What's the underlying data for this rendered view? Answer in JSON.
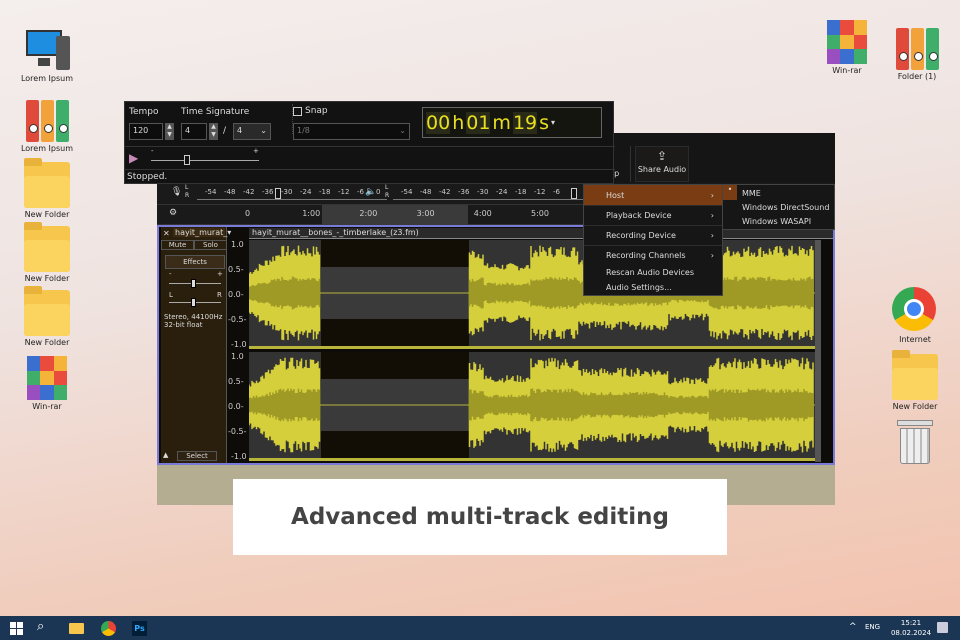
{
  "desktop_left": [
    {
      "label": "Lorem Ipsum",
      "icon": "computer-icon"
    },
    {
      "label": "Lorem Ipsum",
      "icon": "binders-icon"
    },
    {
      "label": "New Folder",
      "icon": "folder-icon"
    },
    {
      "label": "New Folder",
      "icon": "folder-icon"
    },
    {
      "label": "New Folder",
      "icon": "folder-icon"
    },
    {
      "label": "Win-rar",
      "icon": "winrar-icon"
    }
  ],
  "desktop_right": [
    {
      "label": "Win-rar",
      "icon": "winrar-icon"
    },
    {
      "label": "Folder (1)",
      "icon": "binders-icon"
    },
    {
      "label": "Internet",
      "icon": "chrome-icon"
    },
    {
      "label": "New Folder",
      "icon": "folder-icon"
    },
    {
      "label": "",
      "icon": "trash-icon"
    }
  ],
  "toolbar": {
    "tempo_label": "Tempo",
    "tempo_value": "120",
    "time_sig_label": "Time Signature",
    "time_sig_num": "4",
    "time_sig_sep": "/",
    "time_sig_den": "4",
    "snap_label": "Snap",
    "snap_value": "1/8",
    "time_display": {
      "h": "00",
      "h_unit": "h",
      "m": "01",
      "m_unit": "m",
      "s": "19",
      "s_unit": "s"
    },
    "status": "Stopped."
  },
  "setup_label": "etup",
  "share_audio_label": "Share Audio",
  "meter_ticks": [
    "-54",
    "-48",
    "-42",
    "-36",
    "-30",
    "-24",
    "-18",
    "-12",
    "-6",
    "0"
  ],
  "meter_ticks_play": [
    "-54",
    "-48",
    "-42",
    "-36",
    "-30",
    "-24",
    "-18",
    "-12",
    "-6"
  ],
  "ruler": [
    "0",
    "1:00",
    "2:00",
    "3:00",
    "4:00",
    "5:00"
  ],
  "track": {
    "name": "hayit_murat_",
    "clip_name": "hayit_murat__bones_-_timberlake_(z3.fm)",
    "mute": "Mute",
    "solo": "Solo",
    "effects": "Effects",
    "gain_minus": "-",
    "gain_plus": "+",
    "pan_l": "L",
    "pan_r": "R",
    "info1": "Stereo, 44100Hz",
    "info2": "32-bit float",
    "select": "Select",
    "scale": [
      "1.0",
      "0.5-",
      "0.0-",
      "-0.5-",
      "-1.0"
    ]
  },
  "menu": {
    "items": [
      {
        "label": "Host",
        "arrow": "›"
      },
      {
        "label": "Playback Device",
        "arrow": "›"
      },
      {
        "label": "Recording Device",
        "arrow": "›"
      },
      {
        "label": "Recording Channels",
        "arrow": "›"
      },
      {
        "label": "Rescan Audio Devices"
      },
      {
        "label": "Audio Settings..."
      }
    ],
    "submenu": [
      "MME",
      "Windows DirectSound",
      "Windows WASAPI"
    ],
    "selected": "MME"
  },
  "caption": "Advanced multi-track editing",
  "taskbar": {
    "lang": "ENG",
    "time": "15:21",
    "date": "08.02.2024",
    "tray_arrow": "^"
  },
  "colors": {
    "wave": "#d4cf3a",
    "menu_highlight": "#7a3c12",
    "taskbar": "#1b3654",
    "time_digits": "#e6e020"
  }
}
